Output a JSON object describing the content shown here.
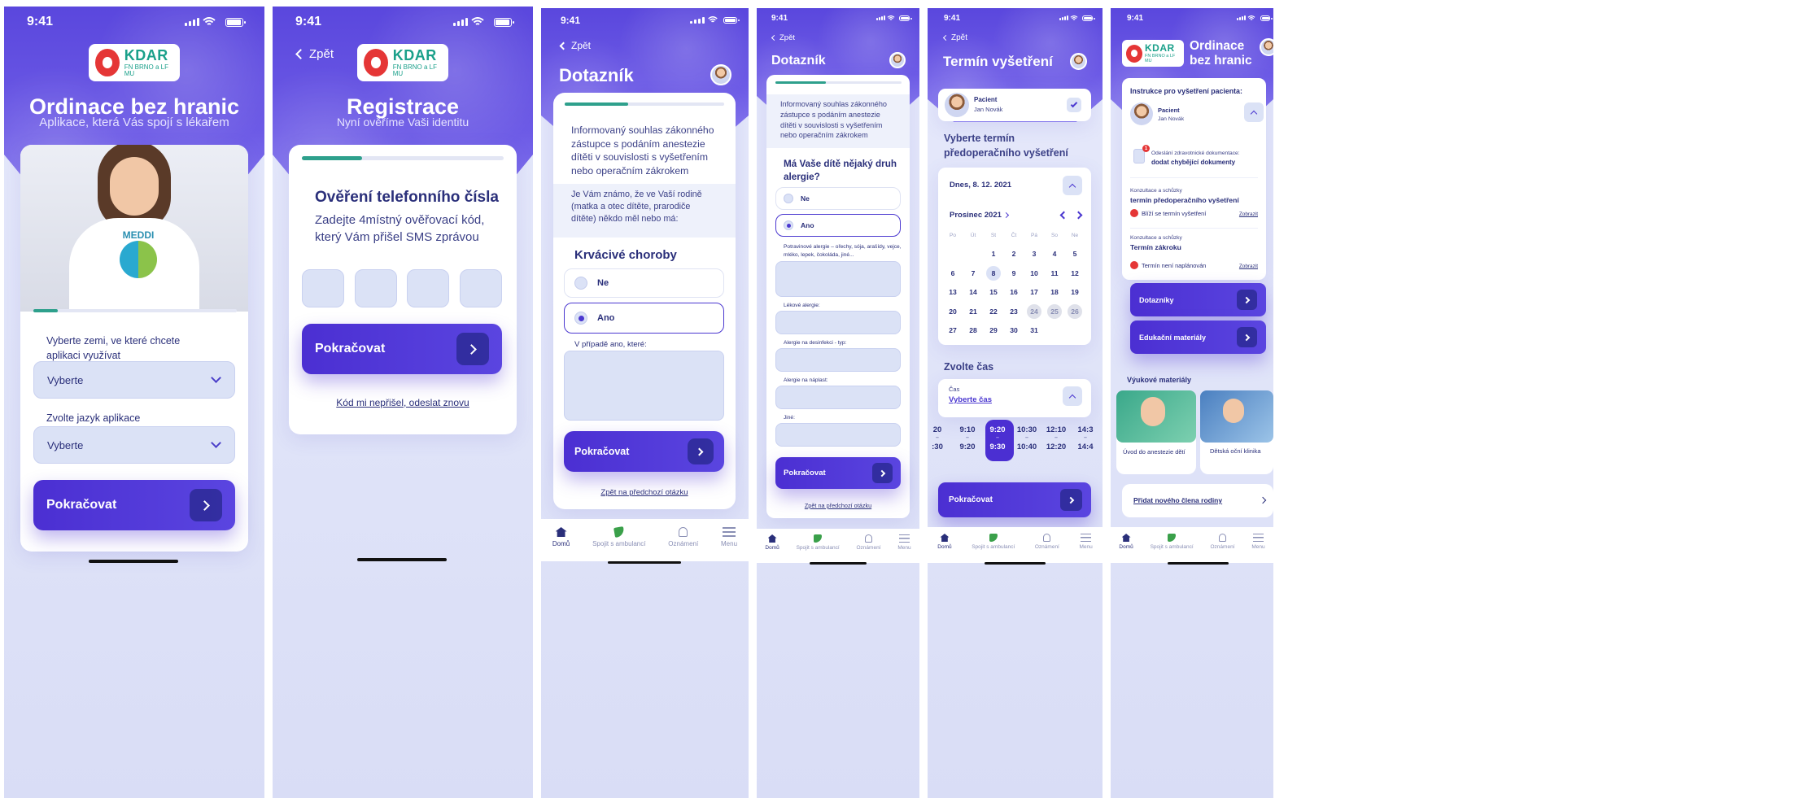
{
  "status_time": "9:41",
  "logo": {
    "brand": "KDAR",
    "sub": "FN BRNO a LF MU"
  },
  "screen1": {
    "title": "Ordinace bez hranic",
    "subtitle": "Aplikace, která Vás spojí s lékařem",
    "meddi": "MEDDI",
    "progress": 0.12,
    "country_label": "Vyberte zemi, ve které chcete aplikaci využívat",
    "country_value": "Vyberte",
    "lang_label": "Zvolte jazyk aplikace",
    "lang_value": "Vyberte",
    "continue": "Pokračovat"
  },
  "screen2": {
    "back": "Zpět",
    "title": "Registrace",
    "subtitle": "Nyní ověříme Vaši identitu",
    "progress": 0.3,
    "heading": "Ověření telefonního čísla",
    "text": "Zadejte 4místný ověřovací kód, který Vám přišel SMS zprávou",
    "continue": "Pokračovat",
    "resend": "Kód mi nepřišel, odeslat znovu"
  },
  "screen3": {
    "back": "Zpět",
    "title": "Dotazník",
    "progress": 0.4,
    "consent": "Informovaný souhlas zákonného zástupce s podáním anestezie dítěti v souvislosti s vyšetřením nebo operačním zákrokem",
    "question": "Je Vám známo, že ve Vaší rodině (matka a otec dítěte, prarodiče dítěte) někdo měl nebo má:",
    "section": "Krvácivé choroby",
    "opt_no": "Ne",
    "opt_yes": "Ano",
    "which": "V případě ano, které:",
    "continue": "Pokračovat",
    "prev": "Zpět na předchozí otázku"
  },
  "screen4": {
    "back": "Zpět",
    "title": "Dotazník",
    "progress": 0.4,
    "consent": "Informovaný souhlas zákonného zástupce s podáním anestezie dítěti v souvislosti s vyšetřením nebo operačním zákrokem",
    "question": "Má Vaše dítě nějaký druh alergie?",
    "opt_no": "Ne",
    "opt_yes": "Ano",
    "food": "Potravinové alergie – ořechy, sója, arašídy, vejce, mléko, lepek, čokoláda, jiné...",
    "drug": "Lékové alergie:",
    "disinf": "Alergie na desinfekci - typ:",
    "plaster": "Alergie na náplast:",
    "other": "Jiné:",
    "continue": "Pokračovat",
    "prev": "Zpět na předchozí otázku"
  },
  "screen5": {
    "back": "Zpět",
    "title": "Termín vyšetření",
    "patient_label": "Pacient",
    "patient_name": "Jan Novák",
    "choose": "Vyberte termín předoperačního vyšetření",
    "today": "Dnes, 8. 12. 2021",
    "month": "Prosinec 2021",
    "dow": [
      "Po",
      "Út",
      "St",
      "Čt",
      "Pá",
      "So",
      "Ne"
    ],
    "days": [
      [
        "",
        "",
        "1",
        "2",
        "3",
        "4",
        "5"
      ],
      [
        "6",
        "7",
        "8",
        "9",
        "10",
        "11",
        "12"
      ],
      [
        "13",
        "14",
        "15",
        "16",
        "17",
        "18",
        "19"
      ],
      [
        "20",
        "21",
        "22",
        "23",
        "24",
        "25",
        "26"
      ],
      [
        "27",
        "28",
        "29",
        "30",
        "31",
        "",
        ""
      ]
    ],
    "time_heading": "Zvolte čas",
    "time_label": "Čas",
    "time_value": "Vyberte čas",
    "times_from": [
      "20",
      "9:10",
      "9:20",
      "10:30",
      "12:10",
      "14:3"
    ],
    "times_to": [
      ":30",
      "9:20",
      "9:30",
      "10:40",
      "12:20",
      "14:4"
    ],
    "continue": "Pokračovat"
  },
  "screen6": {
    "title": "Ordinace bez hranic",
    "instr": "Instrukce pro vyšetření pacienta:",
    "patient_label": "Pacient",
    "patient_name": "Jan Novák",
    "doc_small": "Odeslání zdravotnické dokumentace:",
    "doc_big": "dodat chybějící dokumenty",
    "badge": "1",
    "c1_small": "Konzultace a schůzky",
    "c1_big": "termín předoperačního vyšetření",
    "c1_status": "Blíží se termín vyšetření",
    "c1_link": "Zobrazit",
    "c2_small": "Konzultace a schůzky",
    "c2_big": "Termín zákroku",
    "c2_status": "Termín není naplánován",
    "c2_link": "Zobrazit",
    "btn1": "Dotazníky",
    "btn2": "Edukační materiály",
    "edu": "Výukové materiály",
    "v1_title": "Úvod do anestezie dětí",
    "v2_title": "Dětská oční klinika",
    "add": "Přidat nového člena rodiny"
  },
  "tabs": [
    "Domů",
    "Spojit s ambulancí",
    "Oznámení",
    "Menu"
  ]
}
